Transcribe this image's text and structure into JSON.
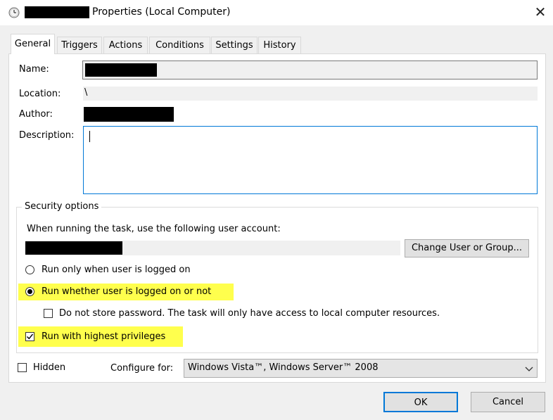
{
  "window": {
    "title": "Properties (Local Computer)",
    "close_glyph": "✕",
    "icon": "clock-icon"
  },
  "tabs": [
    {
      "label": "General",
      "active": true
    },
    {
      "label": "Triggers",
      "active": false
    },
    {
      "label": "Actions",
      "active": false
    },
    {
      "label": "Conditions",
      "active": false
    },
    {
      "label": "Settings",
      "active": false
    },
    {
      "label": "History",
      "active": false
    }
  ],
  "general": {
    "name_label": "Name:",
    "location_label": "Location:",
    "location_value": "\\",
    "author_label": "Author:",
    "description_label": "Description:",
    "description_value": ""
  },
  "security": {
    "title": "Security options",
    "account_prompt": "When running the task, use the following user account:",
    "change_button": "Change User or Group...",
    "radio_logged_on": "Run only when user is logged on",
    "radio_whether": "Run whether user is logged on or not",
    "radio_selected": "whether",
    "do_not_store_password": "Do not store password.  The task will only have access to local computer resources.",
    "do_not_store_checked": false,
    "highest_privileges": "Run with highest privileges",
    "highest_checked": true,
    "highlight_color": "#ffff4d"
  },
  "bottom": {
    "hidden_label": "Hidden",
    "hidden_checked": false,
    "configure_label": "Configure for:",
    "configure_value": "Windows Vista™, Windows Server™ 2008"
  },
  "buttons": {
    "ok": "OK",
    "cancel": "Cancel"
  }
}
